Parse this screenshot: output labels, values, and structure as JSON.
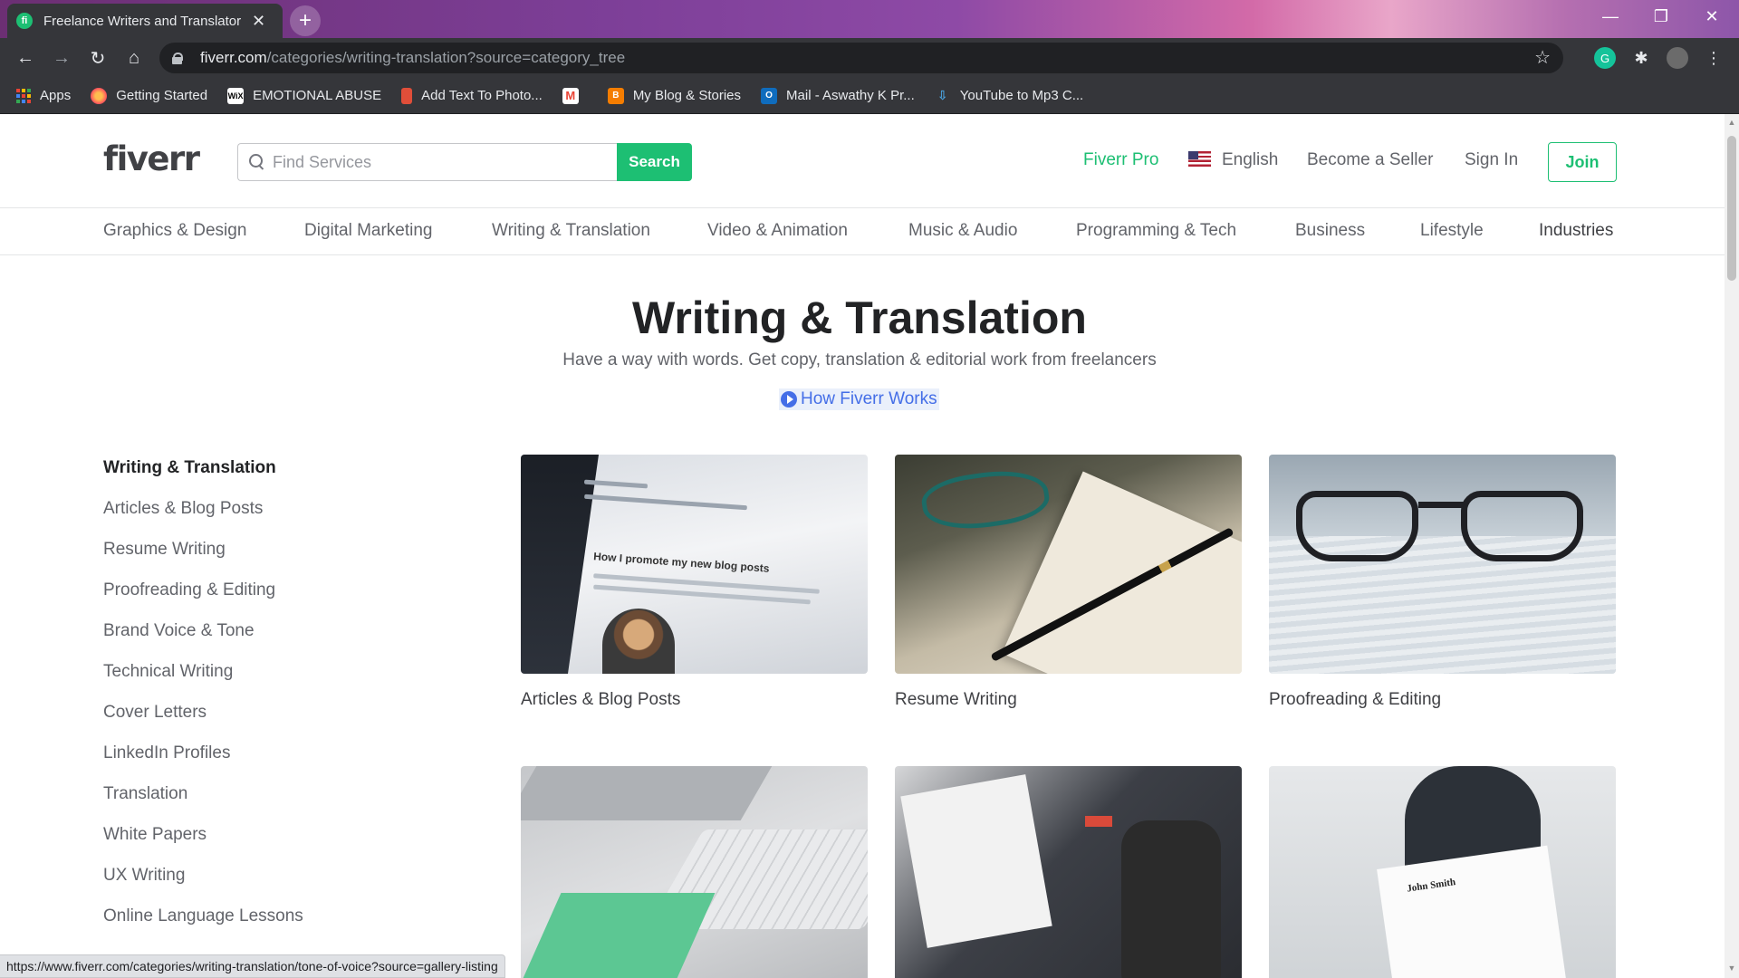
{
  "browser": {
    "tab_title": "Freelance Writers and Translators",
    "tab_favicon": "fi",
    "url_host": "fiverr.com",
    "url_path": "/categories/writing-translation?source=category_tree",
    "bookmarks": [
      {
        "label": "Apps",
        "icon": "apps-grid-icon"
      },
      {
        "label": "Getting Started",
        "icon": "firefox-icon"
      },
      {
        "label": "EMOTIONAL ABUSE",
        "icon": "wix-icon"
      },
      {
        "label": "Add Text To Photo...",
        "icon": "photo-icon"
      },
      {
        "label": "",
        "icon": "gmail-icon"
      },
      {
        "label": "My Blog & Stories",
        "icon": "blogger-icon"
      },
      {
        "label": "Mail - Aswathy K Pr...",
        "icon": "outlook-icon"
      },
      {
        "label": "YouTube to Mp3 C...",
        "icon": "download-icon"
      }
    ],
    "status_url": "https://www.fiverr.com/categories/writing-translation/tone-of-voice?source=gallery-listing"
  },
  "header": {
    "logo": "fiverr",
    "search_placeholder": "Find Services",
    "search_button": "Search",
    "nav": {
      "pro": "Fiverr Pro",
      "language": "English",
      "become_seller": "Become a Seller",
      "sign_in": "Sign In",
      "join": "Join"
    }
  },
  "categories": [
    "Graphics & Design",
    "Digital Marketing",
    "Writing & Translation",
    "Video & Animation",
    "Music & Audio",
    "Programming & Tech",
    "Business",
    "Lifestyle",
    "Industries"
  ],
  "hero": {
    "title": "Writing & Translation",
    "subtitle": "Have a way with words. Get copy, translation & editorial work from freelancers",
    "how_link": "How Fiverr Works"
  },
  "sidebar": {
    "heading": "Writing & Translation",
    "items": [
      "Articles & Blog Posts",
      "Resume Writing",
      "Proofreading & Editing",
      "Brand Voice & Tone",
      "Technical Writing",
      "Cover Letters",
      "LinkedIn Profiles",
      "Translation",
      "White Papers",
      "UX Writing",
      "Online Language Lessons"
    ]
  },
  "cards": [
    {
      "label": "Articles & Blog Posts",
      "image_text": "How I promote my new blog posts"
    },
    {
      "label": "Resume Writing"
    },
    {
      "label": "Proofreading & Editing"
    },
    {
      "label": ""
    },
    {
      "label": ""
    },
    {
      "label": "",
      "image_text": "John Smith"
    }
  ],
  "colors": {
    "brand_green": "#1dbf73",
    "link_blue": "#446ee7",
    "text_dark": "#222325",
    "text_muted": "#62646a"
  }
}
